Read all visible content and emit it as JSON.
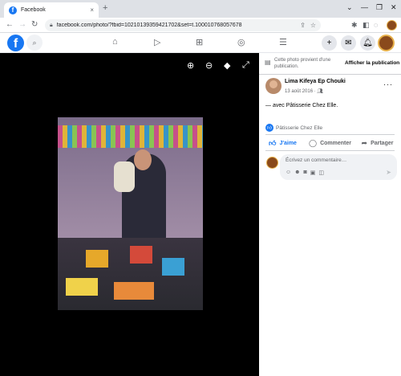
{
  "browser": {
    "tab_title": "Facebook",
    "tab_favicon": "f",
    "tab_close": "×",
    "new_tab": "+",
    "window_controls": [
      "⌄",
      "—",
      "❐",
      "✕"
    ],
    "url": "facebook.com/photo/?fbid=10210139359421702&set=t.100010768057678",
    "nav": {
      "back": "←",
      "forward": "→",
      "reload": "↻"
    }
  },
  "fb_nav": {
    "logo": "f",
    "icons": [
      "home-icon",
      "watch-icon",
      "marketplace-icon",
      "groups-icon",
      "menu-icon"
    ],
    "right_icons": [
      "create-icon",
      "messenger-icon",
      "notifications-icon"
    ]
  },
  "viewer": {
    "tools": [
      "zoom-in-icon",
      "zoom-out-icon",
      "tag-icon",
      "fullscreen-icon"
    ]
  },
  "panel": {
    "notice_text": "Cette photo provient d'une publication.",
    "notice_link": "Afficher la publication",
    "author": "Lima Kifeya Ep Chouki",
    "date": "13 août 2016 · ",
    "audience_icon": "friends-icon",
    "more": "···",
    "caption_prefix": "— avec ",
    "caption_tag": "Pâtisserie Chez Elle",
    "caption_suffix": ".",
    "reaction_name": "Pâtisserie Chez Elle",
    "like_label": "J'aime",
    "comment_label": "Commenter",
    "share_label": "Partager",
    "comment_placeholder": "Écrivez un commentaire…"
  },
  "colors": {
    "brand": "#1877f2",
    "viewer_bg": "#000000"
  }
}
